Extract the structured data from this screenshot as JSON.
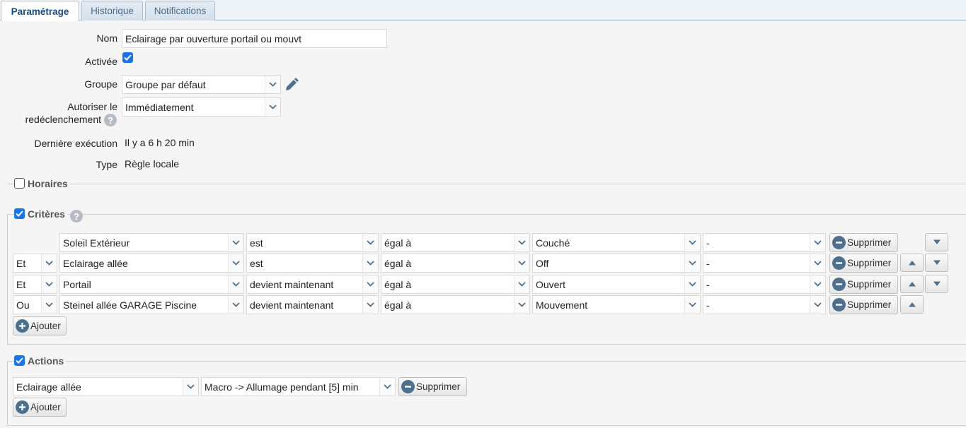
{
  "tabs": [
    "Paramétrage",
    "Historique",
    "Notifications"
  ],
  "form": {
    "nom_label": "Nom",
    "nom_value": "Eclairage par ouverture portail ou mouvt",
    "activee_label": "Activée",
    "groupe_label": "Groupe",
    "groupe_value": "Groupe par défaut",
    "redecl_label_1": "Autoriser le",
    "redecl_label_2": "redéclenchement",
    "redecl_value": "Immédiatement",
    "derniere_label": "Dernière exécution",
    "derniere_value": "Il y a 6 h 20 min",
    "type_label": "Type",
    "type_value": "Règle locale"
  },
  "horaires": {
    "title": "Horaires",
    "checked": false
  },
  "criteres": {
    "title": "Critères",
    "checked": true,
    "rows": [
      {
        "op": "",
        "device": "Soleil Extérieur",
        "verb": "est",
        "cmp": "égal à",
        "value": "Couché",
        "extra": "-",
        "delete": "Supprimer"
      },
      {
        "op": "Et",
        "device": "Eclairage allée",
        "verb": "est",
        "cmp": "égal à",
        "value": "Off",
        "extra": "-",
        "delete": "Supprimer"
      },
      {
        "op": "Et",
        "device": "Portail",
        "verb": "devient maintenant",
        "cmp": "égal à",
        "value": "Ouvert",
        "extra": "-",
        "delete": "Supprimer"
      },
      {
        "op": "Ou",
        "device": "Steinel allée GARAGE Piscine",
        "verb": "devient maintenant",
        "cmp": "égal à",
        "value": "Mouvement",
        "extra": "-",
        "delete": "Supprimer"
      }
    ],
    "add": "Ajouter"
  },
  "actions": {
    "title": "Actions",
    "checked": true,
    "rows": [
      {
        "device": "Eclairage allée",
        "action": "Macro -> Allumage pendant [5] min",
        "delete": "Supprimer"
      }
    ],
    "add": "Ajouter"
  },
  "colors": {
    "accent": "#1a73e8",
    "tab_active_text": "#1a4c7c",
    "button_icon": "#4f6f8f"
  }
}
